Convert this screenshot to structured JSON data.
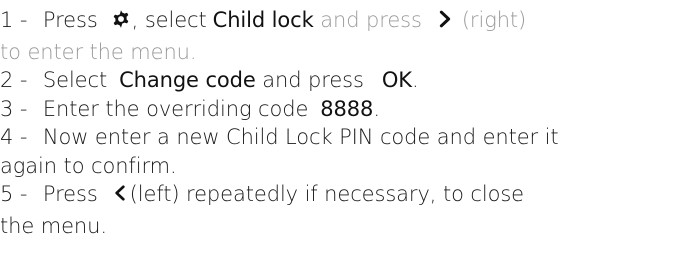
{
  "steps": [
    {
      "lines": [
        {
          "num": "1 - ",
          "pre": "Press",
          "gear_icon": "gear-icon",
          "comma": ", select",
          "b1": "Child lock",
          "g1": " and press",
          "chev_icon": "chevron-right-icon",
          "tail": "(right)"
        },
        {
          "gray": "to enter the menu."
        }
      ]
    },
    {
      "lines": [
        {
          "num": "2 - ",
          "pre": "Select",
          "b1": "Change code",
          "mid": " and press",
          "b2": "OK",
          "tail": "."
        }
      ]
    },
    {
      "lines": [
        {
          "num": "3 - ",
          "pre": "Enter the overriding code",
          "b1": "8888",
          "tail": "."
        }
      ]
    },
    {
      "lines": [
        {
          "num": "4 - ",
          "text": "Now enter a new Child Lock PIN code and enter it"
        },
        {
          "text": "again to confirm."
        }
      ]
    },
    {
      "lines": [
        {
          "num": "5 - ",
          "pre": "Press",
          "chev_icon": "chevron-left-icon",
          "tail": "(left) repeatedly if necessary, to close"
        },
        {
          "text": "the menu."
        }
      ]
    }
  ]
}
